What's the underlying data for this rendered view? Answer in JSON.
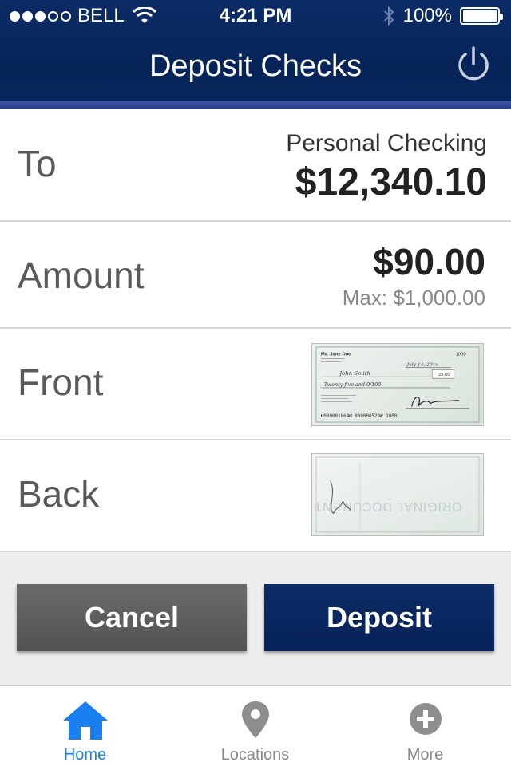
{
  "status_bar": {
    "carrier": "BELL",
    "time": "4:21 PM",
    "battery": "100%"
  },
  "header": {
    "title": "Deposit Checks",
    "power_icon": "power-icon"
  },
  "form": {
    "to_label": "To",
    "account_name": "Personal Checking",
    "account_balance": "$12,340.10",
    "amount_label": "Amount",
    "amount_value": "$90.00",
    "amount_max": "Max: $1,000.00",
    "front_label": "Front",
    "back_label": "Back"
  },
  "check_front": {
    "name": "Ms. Jane Doe",
    "number": "1000",
    "date": "July 14, 20xx",
    "payee": "John Smith",
    "amount": "25.00",
    "written": "Twenty-five and 0/100",
    "micr": "⑆000001864⑆ 000000529⑈ 1000"
  },
  "check_back": {
    "watermark": "ORIGINAL DOCUMENT"
  },
  "actions": {
    "cancel_label": "Cancel",
    "deposit_label": "Deposit"
  },
  "tabs": [
    {
      "label": "Home",
      "icon": "home-icon",
      "active": true
    },
    {
      "label": "Locations",
      "icon": "location-pin-icon",
      "active": false
    },
    {
      "label": "More",
      "icon": "plus-circle-icon",
      "active": false
    }
  ],
  "colors": {
    "header_bg": "#062458",
    "accent_blue": "#1a7ff0",
    "cancel_bg": "#5e5e5e",
    "deposit_bg": "#0a275d"
  }
}
